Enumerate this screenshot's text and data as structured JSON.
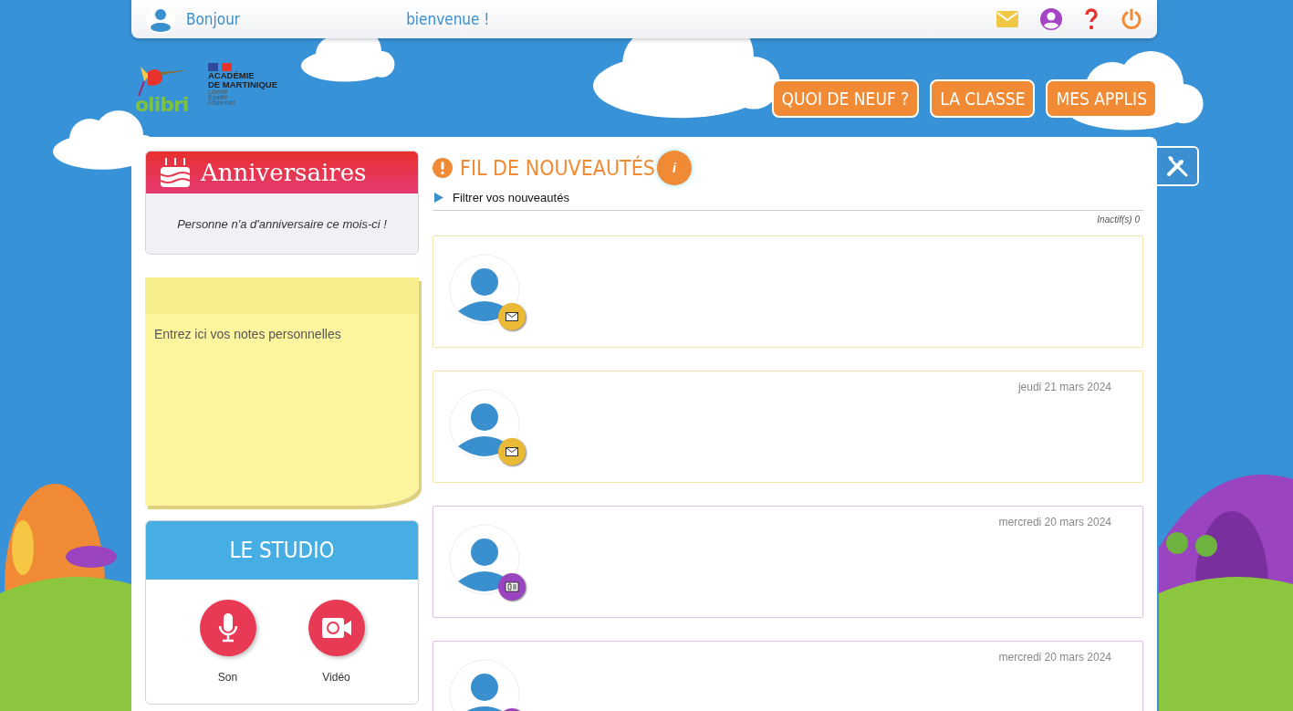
{
  "header": {
    "greeting": "Bonjour",
    "welcome": "bienvenue !"
  },
  "logo": {
    "name": "olibri",
    "academy": [
      "ACADÉMIE",
      "DE MARTINIQUE"
    ],
    "motto": [
      "Liberté",
      "Égalité",
      "Fraternité"
    ]
  },
  "nav": [
    {
      "label": "QUOI DE NEUF ?"
    },
    {
      "label": "LA CLASSE"
    },
    {
      "label": "MES APPLIS"
    }
  ],
  "birthdays": {
    "title": "Anniversaires",
    "message": "Personne n'a d'anniversaire ce mois-ci !"
  },
  "notes": {
    "placeholder": "Entrez ici vos notes personnelles"
  },
  "studio": {
    "title": "LE STUDIO",
    "actions": [
      {
        "kind": "audio",
        "label": "Son"
      },
      {
        "kind": "video",
        "label": "Vidéo"
      }
    ]
  },
  "feed": {
    "title": "FIL DE NOUVEAUTÉS",
    "info": "i",
    "filter": "Filtrer vos nouveautés",
    "inactive": "Inactif(s) 0",
    "items": [
      {
        "kind": "message"
      },
      {
        "kind": "message",
        "date": "jeudi 21 mars 2024"
      },
      {
        "kind": "news",
        "date": "mercredi 20 mars 2024"
      },
      {
        "kind": "news",
        "date": "mercredi 20 mars 2024"
      }
    ]
  }
}
